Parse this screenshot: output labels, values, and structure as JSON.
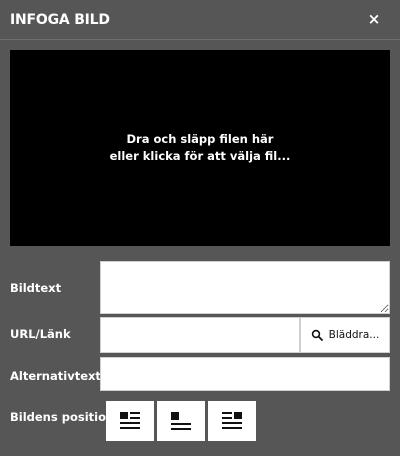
{
  "dialog": {
    "title": "INFOGA BILD",
    "close_icon": "close-icon"
  },
  "dropzone": {
    "line1": "Dra och släpp filen här",
    "line2": "eller klicka för att välja fil..."
  },
  "fields": {
    "caption_label": "Bildtext",
    "caption_value": "",
    "url_label": "URL/Länk",
    "url_value": "",
    "browse_label": "Bläddra...",
    "browse_icon": "search-icon",
    "alt_label": "Alternativtext",
    "alt_value": ""
  },
  "position": {
    "label": "Bildens position",
    "options": [
      {
        "icon": "align-left-icon"
      },
      {
        "icon": "align-center-icon"
      },
      {
        "icon": "align-right-icon"
      }
    ]
  },
  "colors": {
    "background": "#565656",
    "dropzone": "#000000",
    "field": "#ffffff"
  }
}
